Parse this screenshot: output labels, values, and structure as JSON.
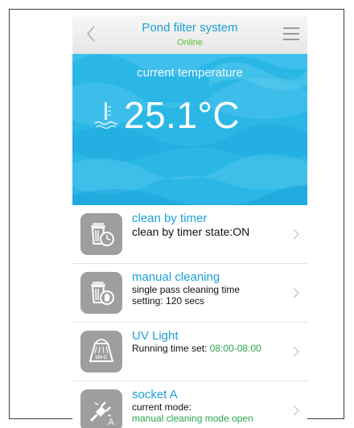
{
  "header": {
    "title": "Pond filter system",
    "status": "Online",
    "back_icon": "chevron-left-icon",
    "menu_icon": "hamburger-menu-icon"
  },
  "hero": {
    "label": "current temperature",
    "temperature": "25.1°C",
    "icon": "thermometer-water-icon",
    "background_color": "#2bb7e6"
  },
  "items": [
    {
      "title": "clean by timer",
      "line1": "clean by timer state:ON",
      "icon": "trash-clock-icon"
    },
    {
      "title": "manual cleaning",
      "line1": "single pass cleaning time",
      "line2": "setting: 120 secs",
      "icon": "trash-hand-icon"
    },
    {
      "title": "UV Light",
      "line1": "Running time set: ",
      "line1_highlight": "08:00-08:00",
      "icon": "uv-lamp-icon",
      "uv_text": "UV-C"
    },
    {
      "title": "socket A",
      "line1": "current mode:",
      "line2": "manual cleaning mode open",
      "icon": "plug-socket-icon",
      "socket_letter": "A"
    }
  ],
  "colors": {
    "accent_blue": "#1d9fd6",
    "online_green": "#5cbf3a",
    "highlight_green": "#2aa64d",
    "icon_gray": "#9e9e9e"
  }
}
